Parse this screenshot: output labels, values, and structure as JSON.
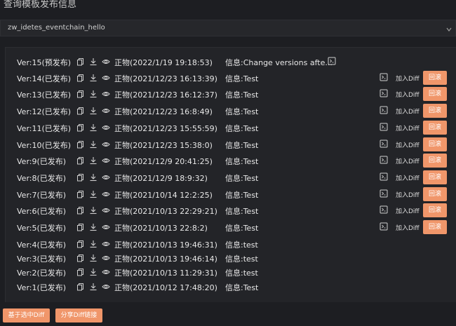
{
  "page_title": "查询模板发布信息",
  "select": {
    "value": "zw_idetes_eventchain_hello"
  },
  "labels": {
    "add_diff": "加入Diff",
    "rollback": "回滚"
  },
  "versions": [
    {
      "ver": "Ver:15(预发布)",
      "author": "正物(2022/1/19 19:18:53)",
      "msg": "信息:Change versions afte...",
      "has_actions": false
    },
    {
      "ver": "Ver:14(已发布)",
      "author": "正物(2021/12/23 16:13:39)",
      "msg": "信息:Test",
      "has_actions": true
    },
    {
      "ver": "Ver:13(已发布)",
      "author": "正物(2021/12/23 16:12:37)",
      "msg": "信息:Test",
      "has_actions": true
    },
    {
      "ver": "Ver:12(已发布)",
      "author": "正物(2021/12/23 16:8:49)",
      "msg": "信息:Test",
      "has_actions": true
    },
    {
      "ver": "Ver:11(已发布)",
      "author": "正物(2021/12/23 15:55:59)",
      "msg": "信息:Test",
      "has_actions": true
    },
    {
      "ver": "Ver:10(已发布)",
      "author": "正物(2021/12/23 15:38:0)",
      "msg": "信息:Test",
      "has_actions": true
    },
    {
      "ver": "Ver:9(已发布)",
      "author": "正物(2021/12/9 20:41:25)",
      "msg": "信息:Test",
      "has_actions": true
    },
    {
      "ver": "Ver:8(已发布)",
      "author": "正物(2021/12/9 18:9:32)",
      "msg": "信息:Test",
      "has_actions": true
    },
    {
      "ver": "Ver:7(已发布)",
      "author": "正物(2021/10/14 12:2:25)",
      "msg": "信息:Test",
      "has_actions": true
    },
    {
      "ver": "Ver:6(已发布)",
      "author": "正物(2021/10/13 22:29:21)",
      "msg": "信息:Test",
      "has_actions": true
    },
    {
      "ver": "Ver:5(已发布)",
      "author": "正物(2021/10/13 22:8:2)",
      "msg": "信息:Test",
      "has_actions": true
    },
    {
      "ver": "Ver:4(已发布)",
      "author": "正物(2021/10/13 19:46:31)",
      "msg": "信息:test",
      "has_actions": false
    },
    {
      "ver": "Ver:3(已发布)",
      "author": "正物(2021/10/13 19:46:14)",
      "msg": "信息:test",
      "has_actions": false
    },
    {
      "ver": "Ver:2(已发布)",
      "author": "正物(2021/10/13 11:29:31)",
      "msg": "信息:test",
      "has_actions": false
    },
    {
      "ver": "Ver:1(已发布)",
      "author": "正物(2021/10/12 17:48:20)",
      "msg": "信息:Test",
      "has_actions": false
    }
  ],
  "footer": {
    "diff_selected": "基于选中Diff",
    "share_diff": "分享Diff链接"
  }
}
